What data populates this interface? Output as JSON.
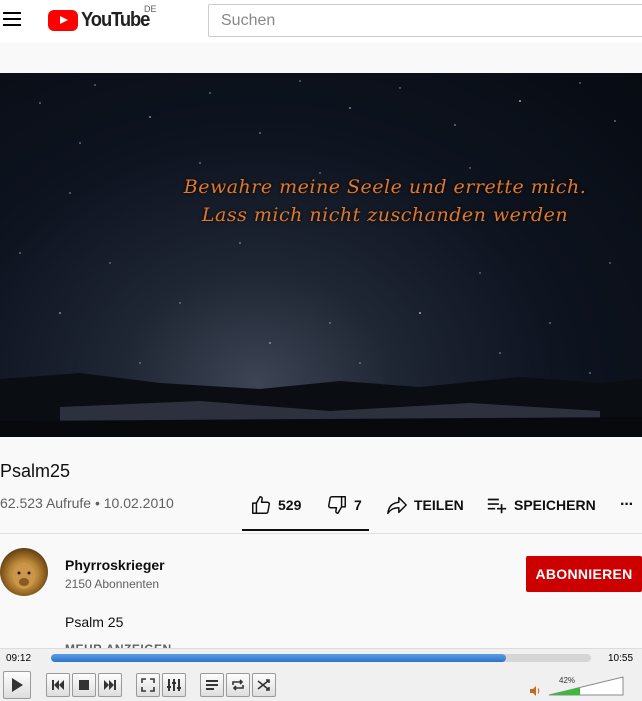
{
  "header": {
    "logo_text": "YouTube",
    "country_code": "DE",
    "search_placeholder": "Suchen"
  },
  "video": {
    "verse_line_1": "Bewahre meine Seele und errette mich.",
    "verse_line_2": "Lass mich nicht zuschanden werden"
  },
  "info": {
    "title": "Psalm25",
    "views_and_date": "62.523 Aufrufe • 10.02.2010",
    "likes": "529",
    "dislikes": "7",
    "share_label": "TEILEN",
    "save_label": "SPEICHERN",
    "more_label": "···",
    "like_ratio": 0.987
  },
  "channel": {
    "name": "Phyrroskrieger",
    "subscribers": "2150 Abonnenten",
    "subscribe_label": "ABONNIEREN",
    "description": "Psalm 25",
    "show_more_label": "MEHR ANZEIGEN"
  },
  "player": {
    "current_time": "09:12",
    "total_time": "10:55",
    "progress": 0.843,
    "volume_label": "42%",
    "volume": 0.42,
    "buttons": [
      "play-icon",
      "previous-icon",
      "stop-icon",
      "next-icon",
      "fullscreen-icon",
      "equalizer-icon",
      "playlist-icon",
      "repeat-icon",
      "shuffle-icon"
    ]
  },
  "colors": {
    "brand_red": "#ff0000",
    "subscribe_red": "#cc0000",
    "verse_orange": "#e0782d",
    "seek_blue": "#2f73c8",
    "volume_green": "#3cba3c"
  }
}
